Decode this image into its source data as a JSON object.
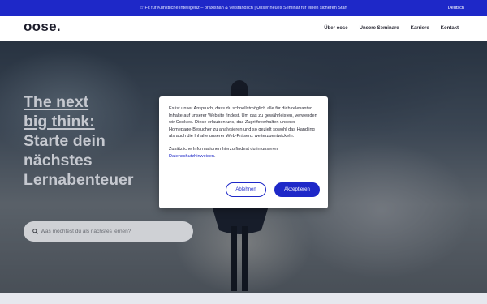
{
  "topbar": {
    "announcement": "☆ Fit für Künstliche Intelligenz – praxisnah & verständlich | Unser neues Seminar für einen sicheren Start",
    "language": "Deutsch"
  },
  "nav": {
    "logo": "oose.",
    "items": [
      {
        "label": "Über oose"
      },
      {
        "label": "Unsere Seminare"
      },
      {
        "label": "Karriere"
      },
      {
        "label": "Kontakt"
      }
    ]
  },
  "hero": {
    "headline_accent_1": "The next",
    "headline_accent_2": "big think:",
    "headline_line_1": "Starte dein",
    "headline_line_2": "nächstes",
    "headline_line_3": "Lernabenteuer",
    "search_placeholder": "Was möchtest du als nächstes lernen?"
  },
  "cookie_modal": {
    "text": "Es ist unser Anspruch, dass du schnellstmöglich alle für dich relevanten Inhalte auf unserer Website findest. Um das zu gewährleisten, verwenden wir Cookies. Diese erlauben uns, das Zugriffsverhalten unserer Homepage-Besucher zu analysieren und so gezielt sowohl das Handling als auch die Inhalte unserer Web-Präsenz weiterzuentwickeln.",
    "info_text": "Zusätzliche Informationen hierzu findest du in unseren",
    "info_link": "Datenschutzhinweisen",
    "info_end": ".",
    "decline_label": "Ablehnen",
    "accept_label": "Akzeptieren"
  },
  "colors": {
    "brand_blue": "#1e28c8",
    "text_dark": "#2d2d38"
  }
}
